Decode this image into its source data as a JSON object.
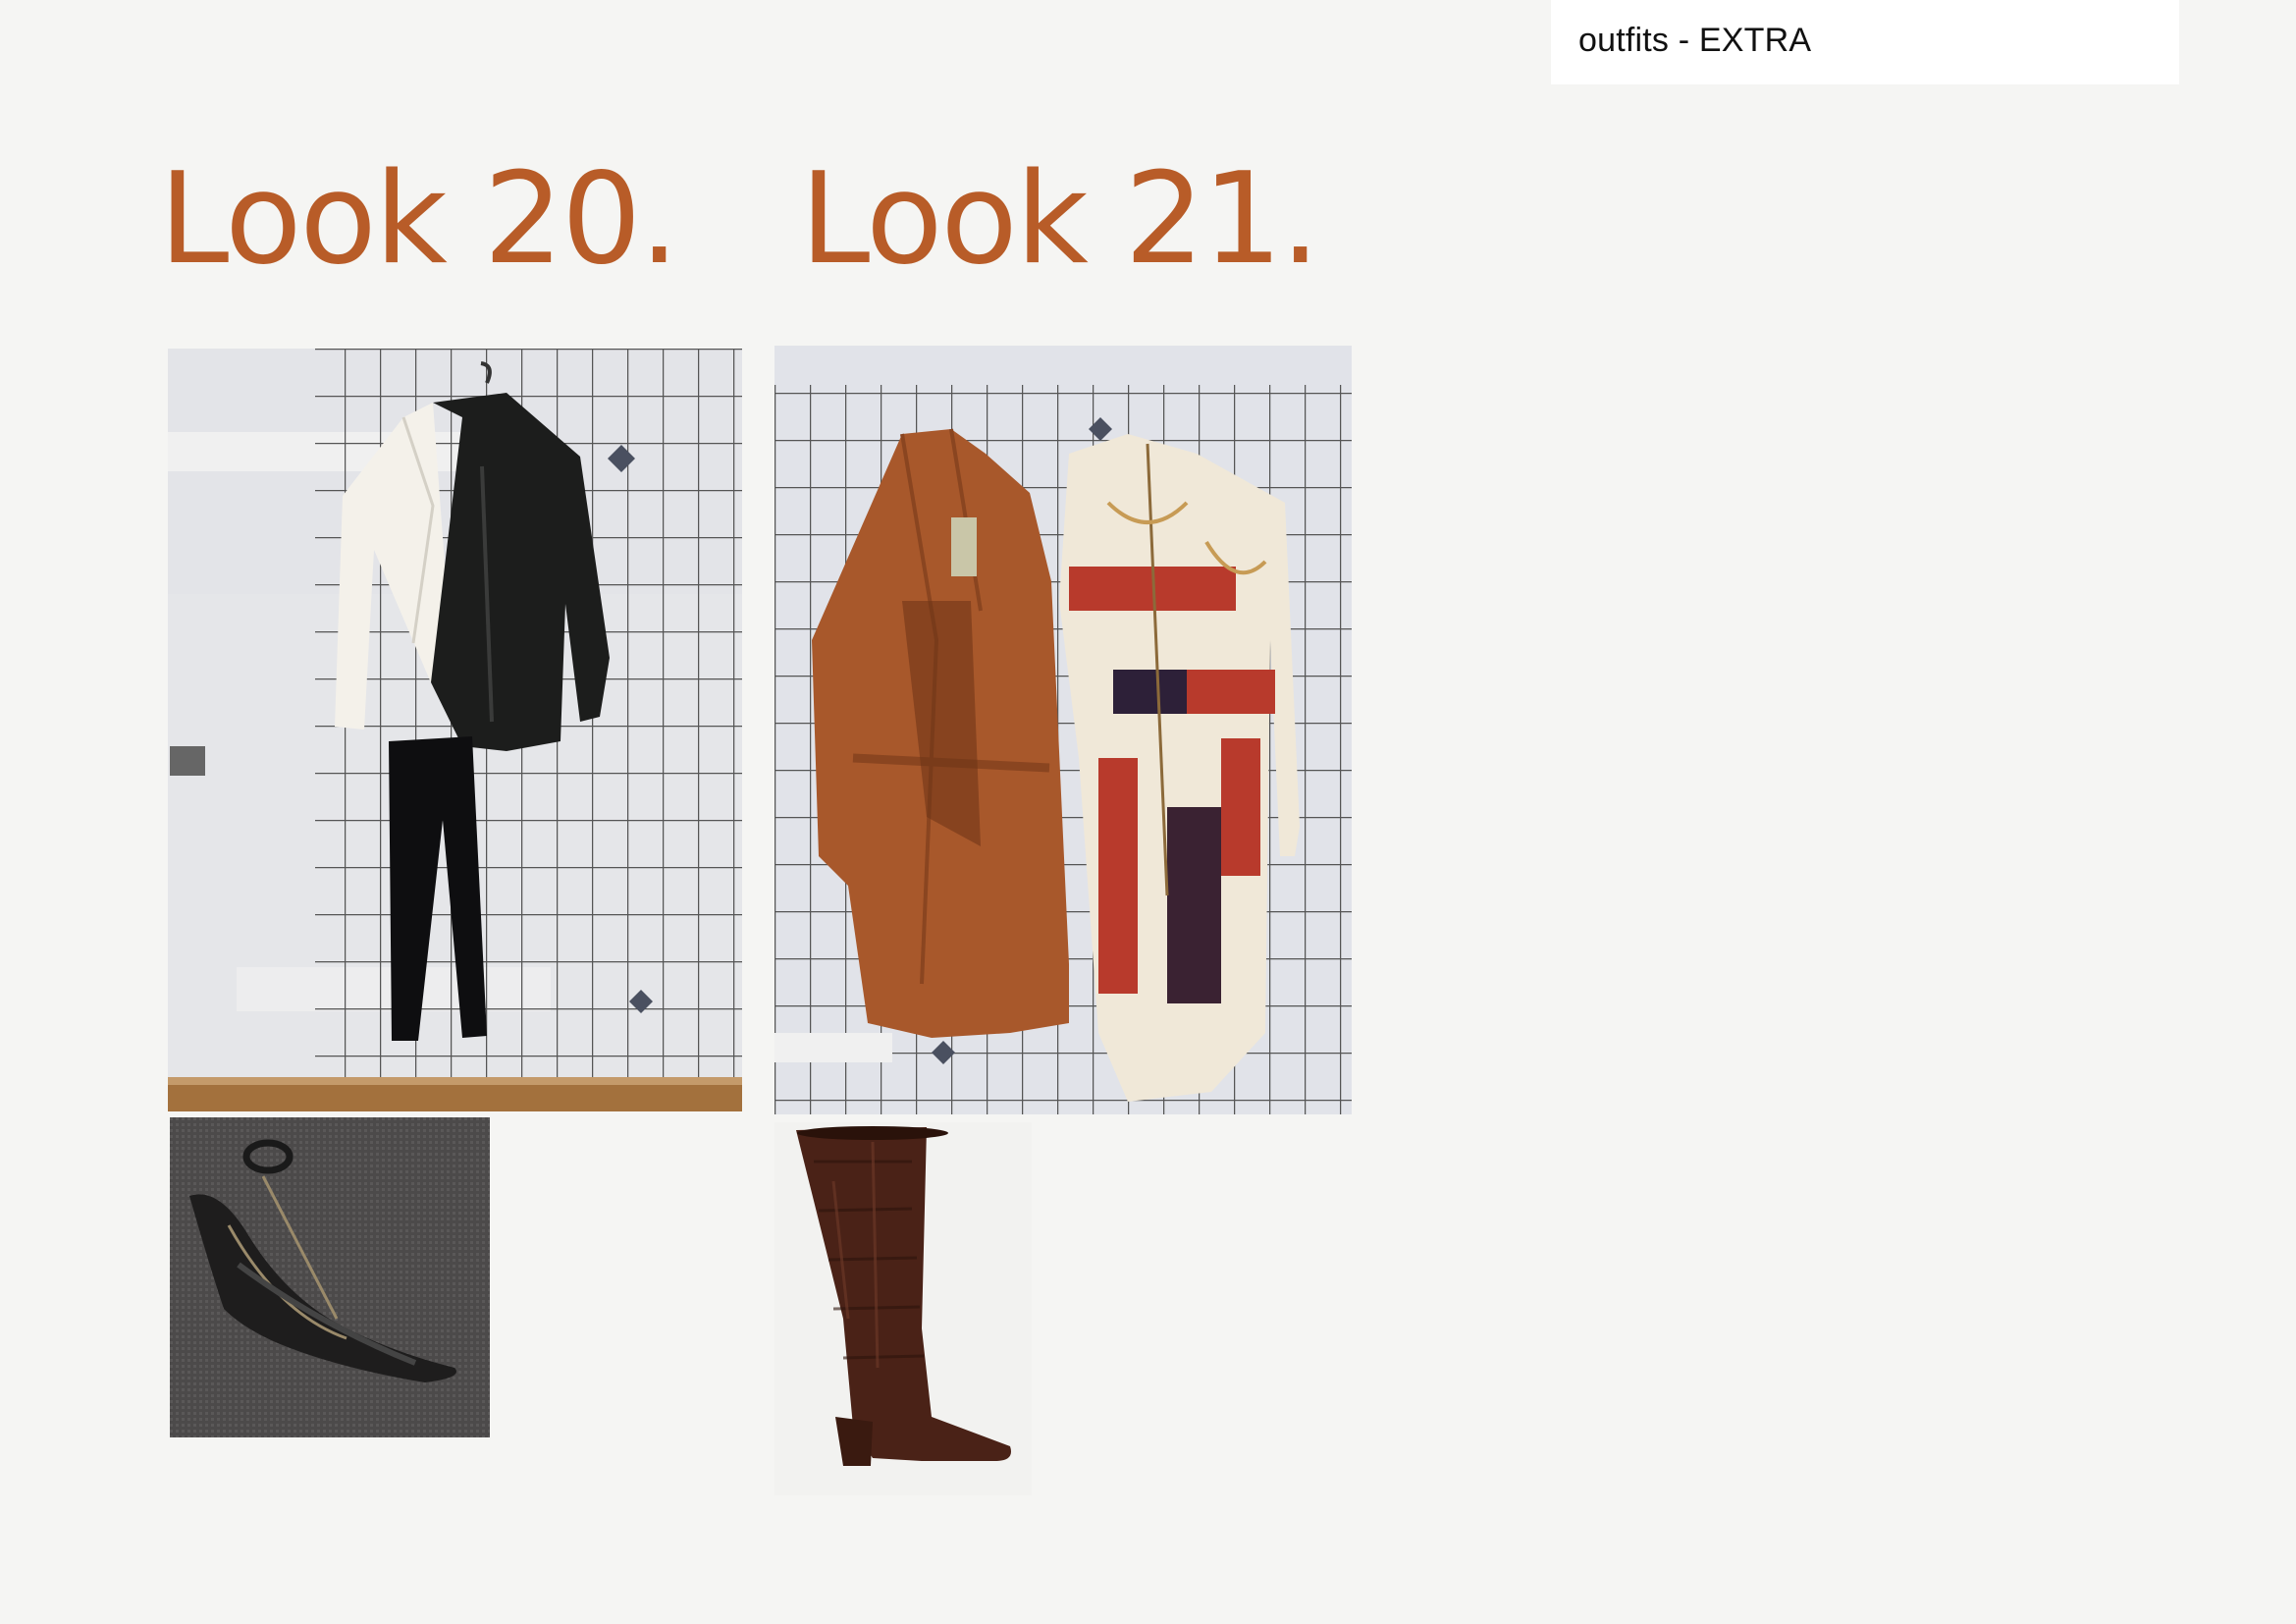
{
  "header": {
    "label": "outfits - EXTRA"
  },
  "looks": [
    {
      "title": "Look 20."
    },
    {
      "title": "Look 21."
    }
  ],
  "colors": {
    "accent": "#b85c28",
    "background": "#f5f5f3"
  }
}
